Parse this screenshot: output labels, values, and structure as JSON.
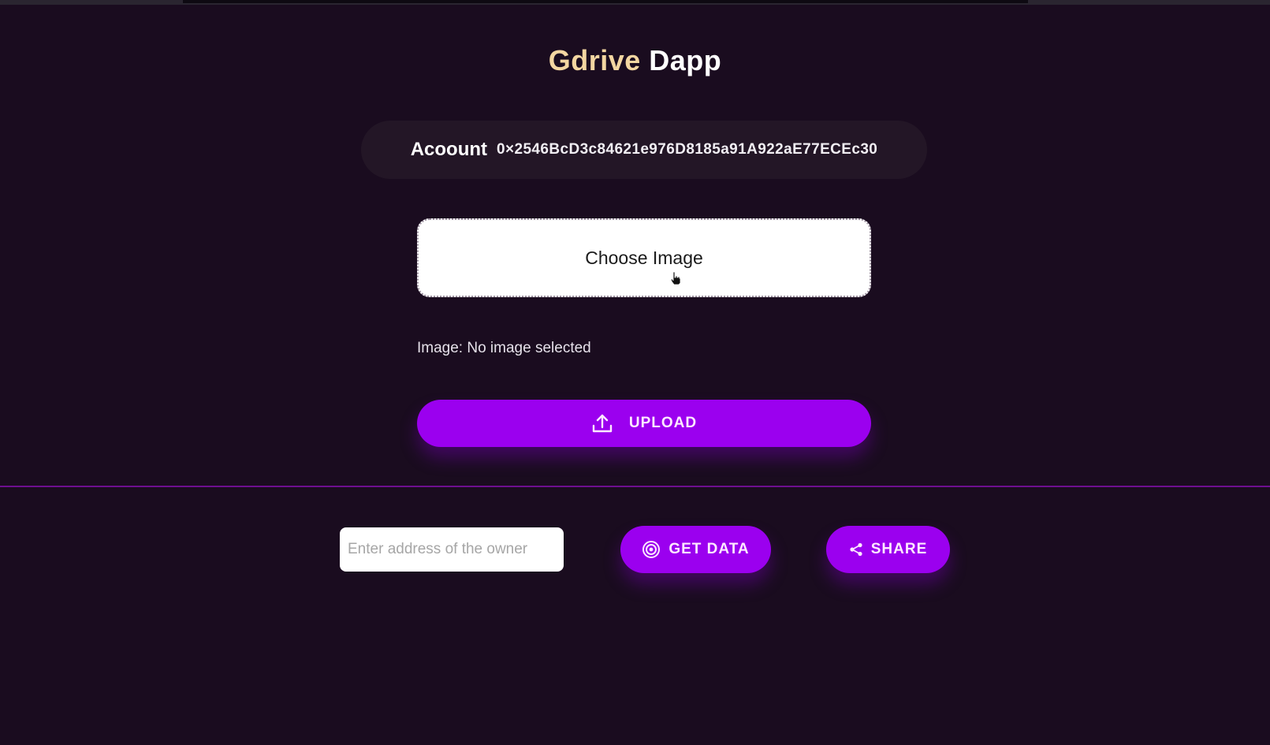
{
  "header": {
    "title_brand": "Gdrive",
    "title_rest": "Dapp"
  },
  "account": {
    "label": "Acoount",
    "address": "0×2546BcD3c84621e976D8185a91A922aE77ECEc30"
  },
  "uploader": {
    "choose_label": "Choose Image",
    "status_text": "Image: No image selected",
    "upload_label": "UPLOAD"
  },
  "share_section": {
    "owner_input_value": "",
    "owner_input_placeholder": "Enter address of the owner",
    "get_data_label": "GET DATA",
    "share_label": "SHARE"
  },
  "icons": {
    "upload": "upload-icon",
    "get_data": "target-icon",
    "share": "share-icon",
    "cursor": "hand-pointer-icon"
  },
  "colors": {
    "background": "#1a0c1f",
    "accent": "#9b00ef",
    "brand_gold": "#f3d6a1",
    "account_pill": "#231626",
    "divider": "#6e0f8f"
  }
}
